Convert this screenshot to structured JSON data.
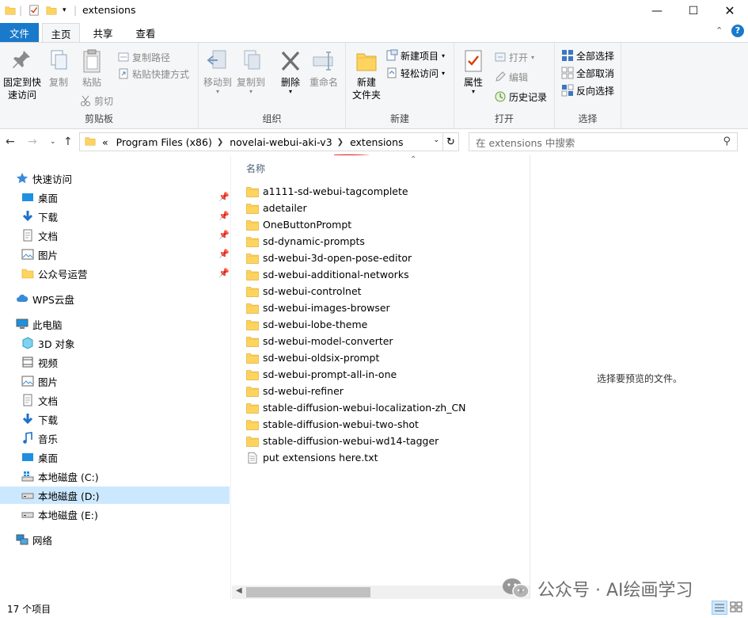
{
  "window": {
    "title": "extensions"
  },
  "tabs": {
    "file": "文件",
    "home": "主页",
    "share": "共享",
    "view": "查看"
  },
  "ribbon": {
    "clipboard": {
      "label": "剪贴板",
      "pin": "固定到快\n速访问",
      "pin_line1": "固定到快",
      "pin_line2": "速访问",
      "copy": "复制",
      "paste": "粘贴",
      "copy_path": "复制路径",
      "paste_shortcut": "粘贴快捷方式",
      "cut": "剪切"
    },
    "organize": {
      "label": "组织",
      "move_to": "移动到",
      "copy_to": "复制到",
      "delete": "删除",
      "rename": "重命名"
    },
    "new": {
      "label": "新建",
      "new_folder_line1": "新建",
      "new_folder_line2": "文件夹",
      "new_item": "新建项目",
      "easy_access": "轻松访问"
    },
    "open": {
      "label": "打开",
      "properties": "属性",
      "open": "打开",
      "edit": "编辑",
      "history": "历史记录"
    },
    "select": {
      "label": "选择",
      "select_all": "全部选择",
      "select_none": "全部取消",
      "invert": "反向选择"
    }
  },
  "address": {
    "prefix": "«",
    "crumbs": [
      "Program Files (x86)",
      "novelai-webui-aki-v3",
      "extensions"
    ],
    "search_placeholder": "在 extensions 中搜索"
  },
  "sidebar": {
    "quick_access": "快速访问",
    "quick_items": [
      "桌面",
      "下载",
      "文档",
      "图片",
      "公众号运营"
    ],
    "wps": "WPS云盘",
    "this_pc": "此电脑",
    "pc_items": [
      "3D 对象",
      "视频",
      "图片",
      "文档",
      "下载",
      "音乐",
      "桌面",
      "本地磁盘 (C:)",
      "本地磁盘 (D:)",
      "本地磁盘 (E:)"
    ],
    "network": "网络"
  },
  "filelist": {
    "column_name": "名称",
    "folders": [
      "a1111-sd-webui-tagcomplete",
      "adetailer",
      "OneButtonPrompt",
      "sd-dynamic-prompts",
      "sd-webui-3d-open-pose-editor",
      "sd-webui-additional-networks",
      "sd-webui-controlnet",
      "sd-webui-images-browser",
      "sd-webui-lobe-theme",
      "sd-webui-model-converter",
      "sd-webui-oldsix-prompt",
      "sd-webui-prompt-all-in-one",
      "sd-webui-refiner",
      "stable-diffusion-webui-localization-zh_CN",
      "stable-diffusion-webui-two-shot",
      "stable-diffusion-webui-wd14-tagger"
    ],
    "files": [
      "put extensions here.txt"
    ]
  },
  "preview": {
    "message": "选择要预览的文件。"
  },
  "status": {
    "count": "17 个项目"
  },
  "watermark": {
    "text": "公众号 · AI绘画学习"
  },
  "colors": {
    "accent": "#1979ca",
    "folder": "#ffd45e",
    "selected": "#cce8ff"
  }
}
